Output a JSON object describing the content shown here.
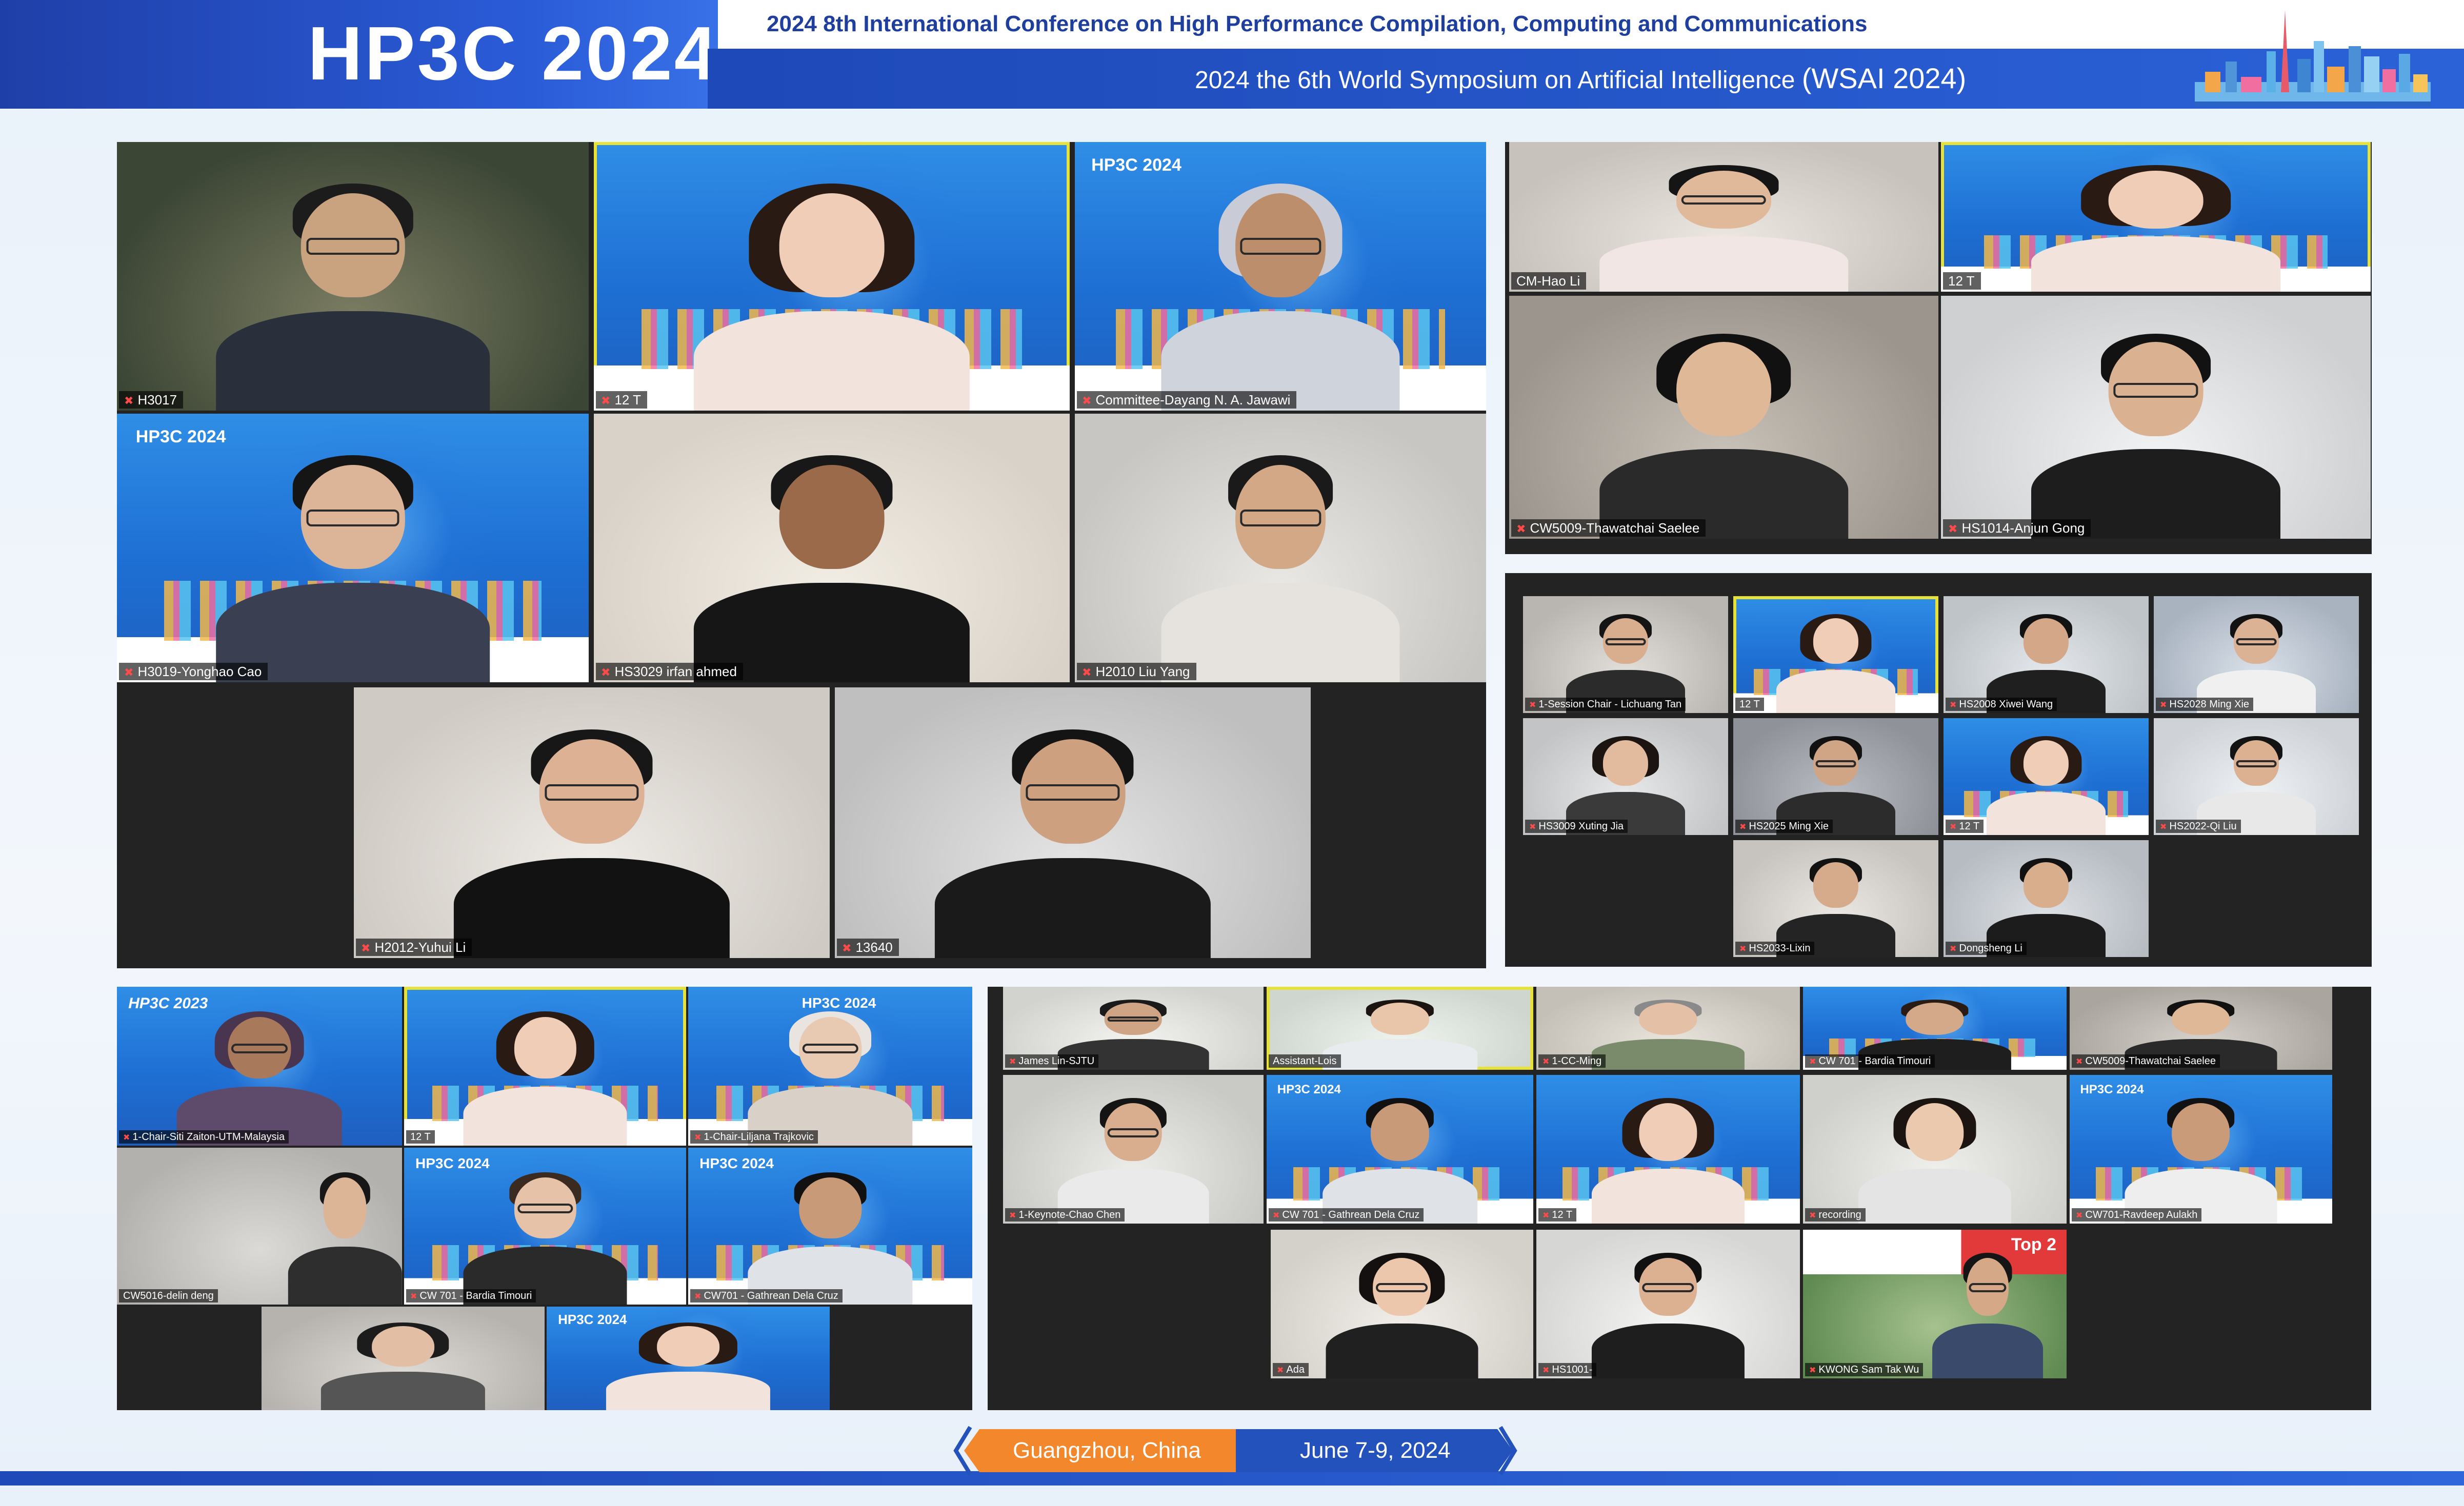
{
  "header": {
    "title": "HP3C 2024",
    "conf_line1": "2024 8th International Conference on High Performance Compilation, Computing and Communications",
    "conf_line2": "2024 the 6th World Symposium on Artificial Intelligence",
    "conf_line2_abbr": "(WSAI 2024)"
  },
  "footer": {
    "location": "Guangzhou, China",
    "dates": "June 7-9, 2024"
  },
  "slide": {
    "title": "HP3C 2024",
    "title_prev": "HP3C 2023"
  },
  "colors": {
    "header_blue": "#1f3fa8",
    "accent_orange": "#f2872c",
    "active_speaker": "#e6e23a",
    "mic_muted": "#ff4a4a"
  },
  "panel_a": {
    "participants": [
      {
        "name": "H3017"
      },
      {
        "name": "12 T"
      },
      {
        "name": "Committee-Dayang N. A. Jawawi"
      },
      {
        "name": "H3019-Yonghao Cao"
      },
      {
        "name": "HS3029 irfan ahmed"
      },
      {
        "name": "H2010 Liu Yang"
      },
      {
        "name": "H2012-Yuhui Li"
      },
      {
        "name": "13640"
      }
    ]
  },
  "panel_b": {
    "participants": [
      {
        "name": "CM-Hao Li"
      },
      {
        "name": "12 T"
      },
      {
        "name": "CW5009-Thawatchai Saelee"
      },
      {
        "name": "HS1014-Anjun Gong"
      }
    ]
  },
  "panel_c": {
    "participants": [
      {
        "name": "1-Session Chair - Lichuang Tan"
      },
      {
        "name": "12 T"
      },
      {
        "name": "HS2008 Xiwei Wang"
      },
      {
        "name": "HS2028 Ming Xie"
      },
      {
        "name": "HS3009 Xuting Jia"
      },
      {
        "name": "HS2025 Ming Xie"
      },
      {
        "name": "12 T"
      },
      {
        "name": "HS2022-Qi Liu"
      },
      {
        "name": "HS2033-Lixin"
      },
      {
        "name": "Dongsheng Li"
      }
    ]
  },
  "panel_d": {
    "participants": [
      {
        "name": "1-Chair-Siti Zaiton-UTM-Malaysia"
      },
      {
        "name": "12 T"
      },
      {
        "name": "1-Chair-Liljana Trajkovic"
      },
      {
        "name": "CW5016-delin deng"
      },
      {
        "name": "CW 701 - Bardia Timouri"
      },
      {
        "name": "CW701 - Gathrean Dela Cruz"
      },
      {
        "name": ""
      },
      {
        "name": ""
      }
    ]
  },
  "panel_e": {
    "participants": [
      {
        "name": "James Lin-SJTU"
      },
      {
        "name": "Assistant-Lois"
      },
      {
        "name": "1-CC-Ming"
      },
      {
        "name": "CW 701 - Bardia Timouri"
      },
      {
        "name": "CW5009-Thawatchai Saelee"
      },
      {
        "name": "1-Keynote-Chao Chen"
      },
      {
        "name": "CW 701 - Gathrean Dela Cruz"
      },
      {
        "name": "12 T"
      },
      {
        "name": "recording"
      },
      {
        "name": "CW701-Ravdeep Aulakh"
      },
      {
        "name": "Ada"
      },
      {
        "name": "HS1001-"
      },
      {
        "name": "KWONG Sam Tak Wu"
      }
    ],
    "poster_badge": "Top 2"
  }
}
